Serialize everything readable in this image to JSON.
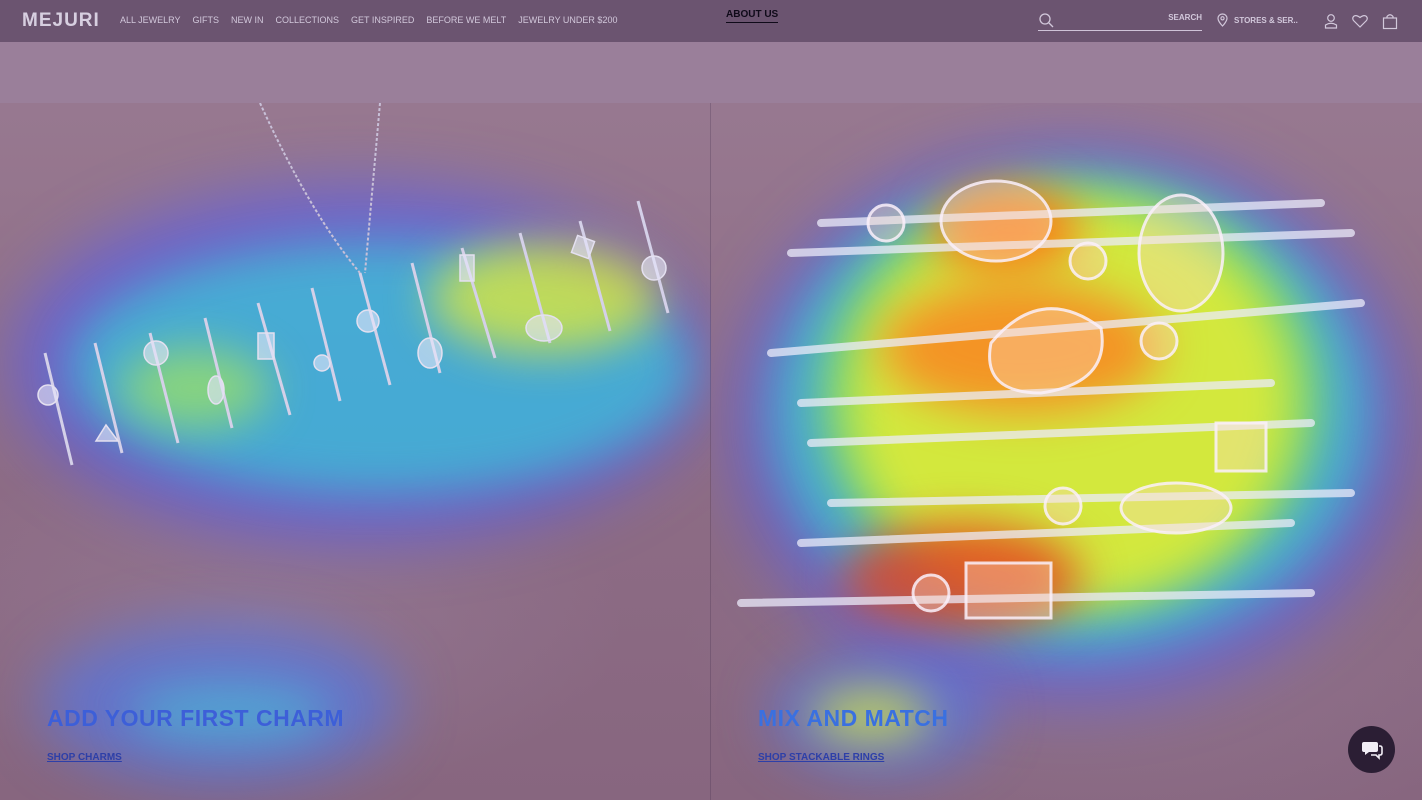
{
  "header": {
    "logo": "MEJURI",
    "nav": [
      "ALL JEWELRY",
      "GIFTS",
      "NEW IN",
      "COLLECTIONS",
      "GET INSPIRED",
      "BEFORE WE MELT",
      "JEWELRY UNDER $200"
    ],
    "about": "ABOUT US",
    "search_label": "SEARCH",
    "stores_label": "STORES & SER..",
    "icons": [
      "search-icon",
      "location-pin-icon",
      "account-icon",
      "heart-icon",
      "shopping-bag-icon"
    ]
  },
  "left_panel": {
    "headline": "ADD YOUR FIRST CHARM",
    "link": "SHOP CHARMS"
  },
  "right_panel": {
    "headline": "MIX AND MATCH",
    "link": "SHOP STACKABLE RINGS"
  },
  "chat": {
    "icon": "chat-bubble-icon"
  },
  "colors": {
    "header_bg": "#6b5470",
    "strip_bg": "#9a7f9a",
    "chat_bg": "#2b1e34",
    "headline_left": "#3d5fd8",
    "headline_right": "#3a70e0",
    "link": "#2d3fa8"
  }
}
